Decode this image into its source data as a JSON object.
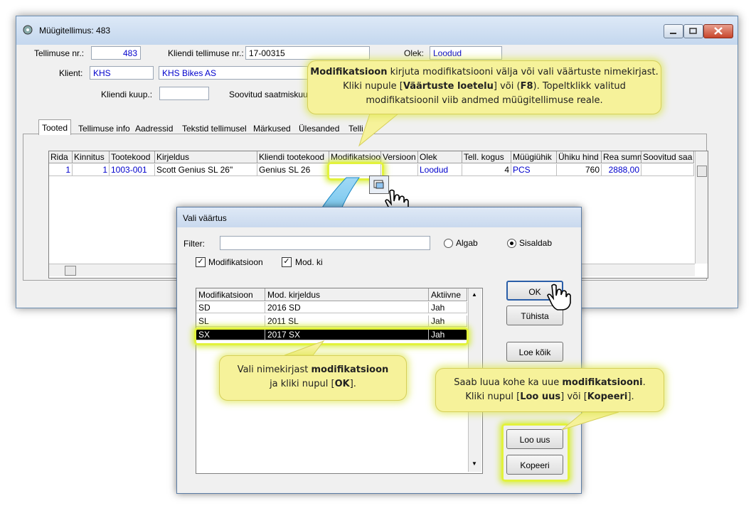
{
  "window": {
    "title": "Müügitellimus: 483"
  },
  "header": {
    "order_nr_label": "Tellimuse nr.:",
    "order_nr": "483",
    "client_order_label": "Kliendi tellimuse nr.:",
    "client_order": "17-00315",
    "status_label": "Olek:",
    "status": "Loodud",
    "client_label": "Klient:",
    "client_code": "KHS",
    "client_name": "KHS Bikes AS",
    "contact_label": "Kliendi kuup.:",
    "contact": "",
    "delivery_label": "Soovitud saatmiskuup"
  },
  "tabs": [
    "Tooted",
    "Tellimuse info",
    "Aadressid",
    "Tekstid tellimusel",
    "Märkused",
    "Ülesanded",
    "Telli"
  ],
  "grid": {
    "columns": [
      "Rida",
      "Kinnitus",
      "Tootekood",
      "Kirjeldus",
      "Kliendi tootekood",
      "Modifikatsioo",
      "Versioon",
      "Olek",
      "Tell. kogus",
      "Müügiühik",
      "Ühiku hind",
      "Rea summ",
      "Soovitud saa"
    ],
    "row": {
      "rida": "1",
      "kinnitus": "1",
      "tootekood": "1003-001",
      "kirjeldus": "Scott Genius SL 26\"",
      "kliendi_tootekood": "Genius SL 26",
      "modifikatsioon": "",
      "versioon": "",
      "olek": "Loodud",
      "kogus": "4",
      "uhik": "PCS",
      "hind": "760",
      "summa": "2888,00",
      "soovitud": ""
    }
  },
  "dialog": {
    "title": "Vali väärtus",
    "filter_label": "Filter:",
    "filter_value": "",
    "radio_starts": "Algab",
    "radio_contains": "Sisaldab",
    "chk_mod": "Modifikatsioon",
    "chk_desc": "Mod. ki",
    "columns": [
      "Modifikatsioon",
      "Mod. kirjeldus",
      "Aktiivne"
    ],
    "rows": [
      {
        "code": "SD",
        "desc": "2016 SD",
        "active": "Jah"
      },
      {
        "code": "SL",
        "desc": "2011 SL",
        "active": "Jah"
      },
      {
        "code": "SX",
        "desc": "2017 SX",
        "active": "Jah"
      }
    ],
    "buttons": {
      "ok": "OK",
      "cancel": "Tühista",
      "load_all": "Loe kõik",
      "new": "Loo uus",
      "copy": "Kopeeri"
    }
  },
  "callouts": {
    "top_1": "Modifikatsioon",
    "top_2": " kirjuta modifikatsiooni välja või vali väärtuste nimekirjast. Kliki nupule [",
    "top_3": "Väärtuste loetelu",
    "top_4": "] või (",
    "top_5": "F8",
    "top_6": "). Topeltklikk valitud modifikatsioonil viib andmed müügitellimuse reale.",
    "mid_1": "Vali nimekirjast ",
    "mid_2": "modifikatsioon",
    "mid_3": "ja kliki nupul [",
    "mid_4": "OK",
    "mid_5": "].",
    "right_1": "Saab luua kohe ka uue ",
    "right_2": "modifikatsiooni",
    "right_3": ".",
    "right_4": "Kliki nupul [",
    "right_5": "Loo uus",
    "right_6": "] või [",
    "right_7": "Kopeeri",
    "right_8": "]."
  }
}
